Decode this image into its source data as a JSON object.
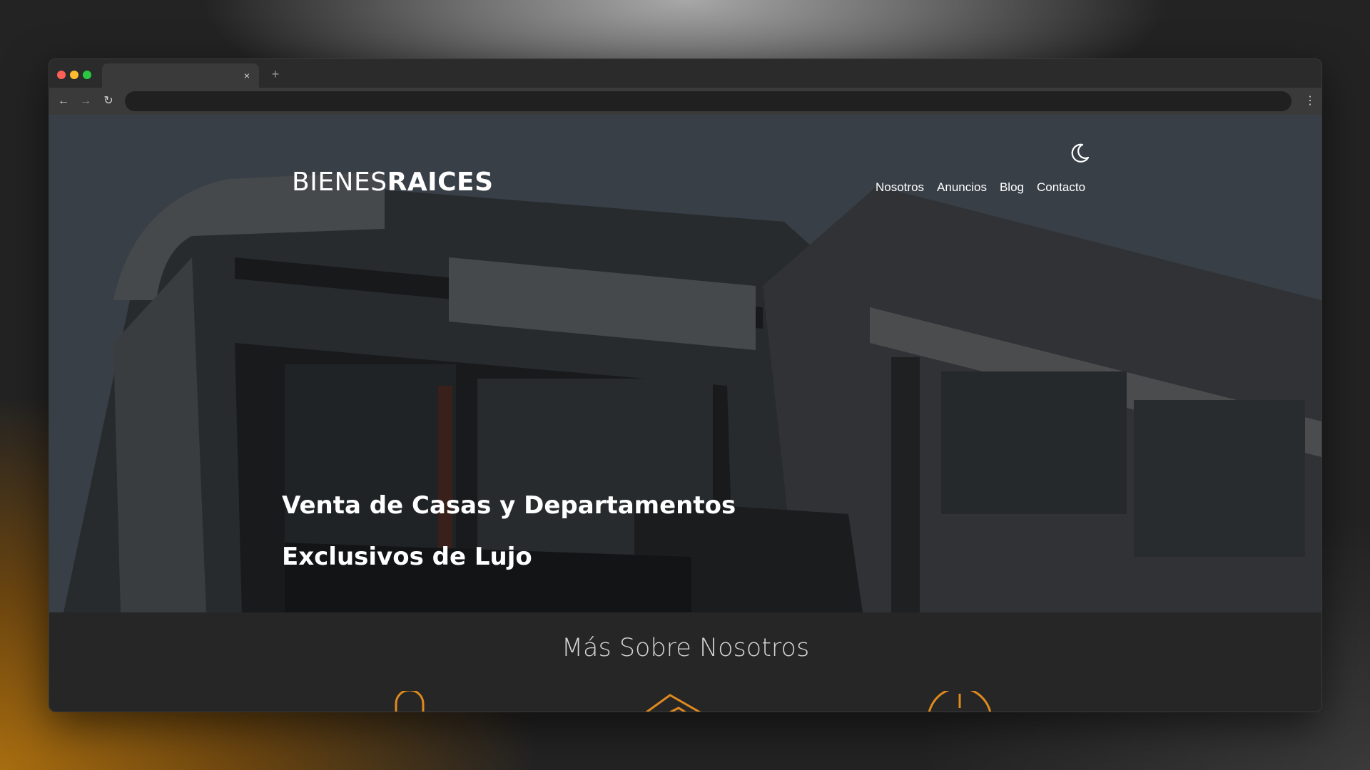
{
  "browser": {
    "tab_close_glyph": "×",
    "new_tab_glyph": "+",
    "back_glyph": "←",
    "forward_glyph": "→",
    "reload_glyph": "↻",
    "menu_glyph": "⋮"
  },
  "site": {
    "logo_light": "BIENES",
    "logo_bold": "RAICES",
    "theme_toggle_icon": "moon-icon",
    "nav": [
      {
        "label": "Nosotros"
      },
      {
        "label": "Anuncios"
      },
      {
        "label": "Blog"
      },
      {
        "label": "Contacto"
      }
    ],
    "hero_line1": "Venta de Casas y Departamentos",
    "hero_line2": "Exclusivos de Lujo",
    "section_title": "Más Sobre Nosotros",
    "feature_icons": [
      "security-icon",
      "price-tag-icon",
      "clock-icon"
    ]
  },
  "colors": {
    "accent": "#e08a1e",
    "page_dark": "#262626"
  }
}
